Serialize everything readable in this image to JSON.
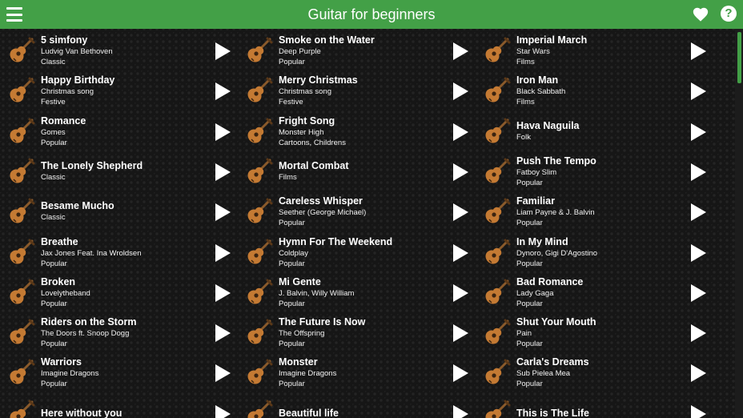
{
  "app": {
    "title": "Guitar for beginners"
  },
  "toolbar": {
    "menu_icon": "menu-icon",
    "favorites_icon": "heart-icon",
    "help_icon": "help-icon",
    "help_glyph": "?"
  },
  "colors": {
    "accent": "#43a047",
    "background": "#161616",
    "text": "#ffffff"
  },
  "columns": [
    [
      {
        "name": "5 simfony",
        "lines": [
          "Ludvig Van Bethoven",
          "Classic"
        ]
      },
      {
        "name": "Happy Birthday",
        "lines": [
          "Christmas song",
          "Festive"
        ]
      },
      {
        "name": "Romance",
        "lines": [
          "Gomes",
          "Popular"
        ]
      },
      {
        "name": "The Lonely Shepherd",
        "lines": [
          "Classic"
        ]
      },
      {
        "name": "Besame Mucho",
        "lines": [
          "Classic"
        ]
      },
      {
        "name": "Breathe",
        "lines": [
          "Jax Jones Feat. Ina Wroldsen",
          "Popular"
        ]
      },
      {
        "name": "Broken",
        "lines": [
          "Lovelytheband",
          "Popular"
        ]
      },
      {
        "name": "Riders on the Storm",
        "lines": [
          "The Doors ft. Snoop Dogg",
          "Popular"
        ]
      },
      {
        "name": "Warriors",
        "lines": [
          "Imagine Dragons",
          "Popular"
        ]
      },
      {
        "name": "Here without you",
        "lines": []
      }
    ],
    [
      {
        "name": "Smoke on the Water",
        "lines": [
          "Deep Purple",
          "Popular"
        ]
      },
      {
        "name": "Merry Christmas",
        "lines": [
          "Christmas song",
          "Festive"
        ]
      },
      {
        "name": "Fright Song",
        "lines": [
          "Monster High",
          "Cartoons, Childrens"
        ]
      },
      {
        "name": "Mortal Combat",
        "lines": [
          "Films"
        ]
      },
      {
        "name": "Careless Whisper",
        "lines": [
          "Seether (George Michael)",
          "Popular"
        ]
      },
      {
        "name": "Hymn For The Weekend",
        "lines": [
          "Coldplay",
          "Popular"
        ]
      },
      {
        "name": "Mi Gente",
        "lines": [
          "J. Balvin, Willy William",
          "Popular"
        ]
      },
      {
        "name": "The Future Is Now",
        "lines": [
          "The Offspring",
          "Popular"
        ]
      },
      {
        "name": "Monster",
        "lines": [
          "Imagine Dragons",
          "Popular"
        ]
      },
      {
        "name": "Beautiful life",
        "lines": []
      }
    ],
    [
      {
        "name": "Imperial March",
        "lines": [
          "Star Wars",
          "Films"
        ]
      },
      {
        "name": "Iron Man",
        "lines": [
          "Black Sabbath",
          "Films"
        ]
      },
      {
        "name": "Hava Naguila",
        "lines": [
          "Folk"
        ]
      },
      {
        "name": "Push The Tempo",
        "lines": [
          "Fatboy Slim",
          "Popular"
        ]
      },
      {
        "name": "Familiar",
        "lines": [
          "Liam Payne & J. Balvin",
          "Popular"
        ]
      },
      {
        "name": "In My Mind",
        "lines": [
          "Dynoro, Gigi D'Agostino",
          "Popular"
        ]
      },
      {
        "name": "Bad Romance",
        "lines": [
          "Lady Gaga",
          "Popular"
        ]
      },
      {
        "name": "Shut Your Mouth",
        "lines": [
          "Pain",
          "Popular"
        ]
      },
      {
        "name": "Carla's Dreams",
        "lines": [
          "Sub Pielea Mea",
          "Popular"
        ]
      },
      {
        "name": "This is The Life",
        "lines": []
      }
    ]
  ]
}
